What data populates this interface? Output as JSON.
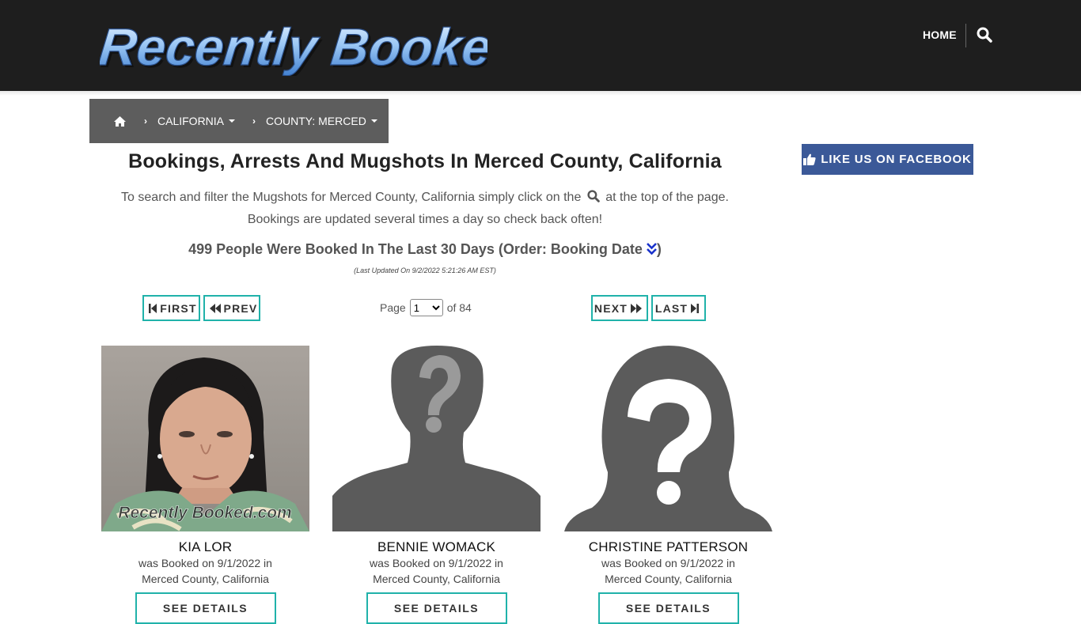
{
  "header": {
    "logo_text": "Recently Booked",
    "nav_home": "HOME",
    "search_icon": "search-icon"
  },
  "breadcrumb": {
    "home_icon": "home-icon",
    "state": "CALIFORNIA",
    "county": "COUNTY: MERCED"
  },
  "facebook": {
    "label": "LIKE US ON FACEBOOK",
    "icon": "thumbs-up-icon",
    "color": "#3b5998"
  },
  "main": {
    "title": "Bookings, Arrests And Mugshots In Merced County, California",
    "desc_part1": "To search and filter the Mugshots for Merced County, California simply click on the",
    "desc_part2": "at the top of the page.",
    "desc_line2": "Bookings are updated several times a day so check back often!",
    "count_text": "499 People Were Booked In The Last 30 Days (Order: Booking Date",
    "count_close": ")",
    "updated": "(Last Updated On 9/2/2022 5:21:26 AM EST)"
  },
  "pager": {
    "first": "FIRST",
    "prev": "PREV",
    "page_label": "Page",
    "page_value": "1",
    "of_label": "of 84",
    "next": "NEXT",
    "last": "LAST",
    "accent": "#20b2aa"
  },
  "cards": [
    {
      "name": "KIA LOR",
      "line1": "was Booked on 9/1/2022 in",
      "line2": "Merced County, California",
      "details": "SEE DETAILS",
      "watermark": "Recently Booked.com"
    },
    {
      "name": "BENNIE WOMACK",
      "line1": "was Booked on 9/1/2022 in",
      "line2": "Merced County, California",
      "details": "SEE DETAILS"
    },
    {
      "name": "CHRISTINE PATTERSON",
      "line1": "was Booked on 9/1/2022 in",
      "line2": "Merced County, California",
      "details": "SEE DETAILS"
    }
  ]
}
